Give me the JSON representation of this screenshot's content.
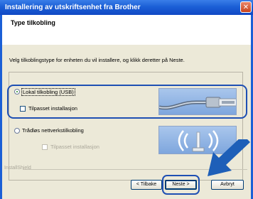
{
  "window": {
    "title": "Installering av utskriftsenhet fra Brother",
    "close_glyph": "✕"
  },
  "header": {
    "title": "Type tilkobling"
  },
  "instruction": "Velg tilkoblingstype for enheten du vil installere, og klikk deretter på Neste.",
  "options": {
    "local": {
      "label": "Lokal tilkobling (USB)",
      "selected": true,
      "custom_install_label": "Tilpasset installasjon",
      "custom_install_checked": false,
      "icon": "usb-cable-icon"
    },
    "wireless": {
      "label": "Trådløs nettverkstilkobling",
      "selected": false,
      "custom_install_label": "Tilpasset installasjon",
      "custom_install_checked": false,
      "custom_install_enabled": false,
      "icon": "wireless-signal-icon"
    }
  },
  "footer": {
    "brand": "InstallShield"
  },
  "buttons": {
    "back": "< Tilbake",
    "next": "Neste >",
    "cancel": "Avbryt"
  },
  "colors": {
    "titlebar": "#1b5fd6",
    "highlight": "#1e4fb3",
    "arrow": "#1e5fb8"
  }
}
